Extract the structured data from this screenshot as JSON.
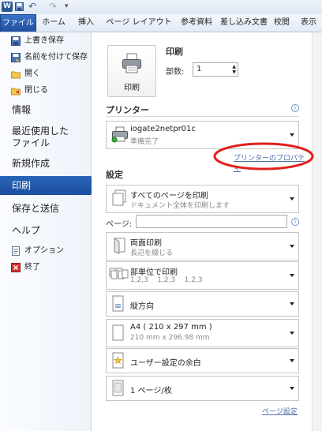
{
  "quick_access": {
    "app_icon_label": "W",
    "customize_label": "▾"
  },
  "ribbon": {
    "tabs": [
      "ファイル",
      "ホーム",
      "挿入",
      "ページ レイアウト",
      "参考資料",
      "差し込み文書",
      "校閲",
      "表示"
    ]
  },
  "backstage_nav": {
    "small_items_top": [
      {
        "label": "上書き保存",
        "icon": "save-icon"
      },
      {
        "label": "名前を付けて保存",
        "icon": "save-as-icon"
      },
      {
        "label": "開く",
        "icon": "open-folder-icon"
      },
      {
        "label": "閉じる",
        "icon": "close-folder-icon"
      }
    ],
    "big_items": [
      "情報",
      "最近使用した\nファイル",
      "新規作成",
      "印刷",
      "保存と送信",
      "ヘルプ"
    ],
    "selected": "印刷",
    "small_items_bottom": [
      {
        "label": "オプション",
        "icon": "options-icon"
      },
      {
        "label": "終了",
        "icon": "exit-icon"
      }
    ]
  },
  "print_panel": {
    "print_heading": "印刷",
    "print_button_label": "印刷",
    "copies_label": "部数:",
    "copies_value": "1",
    "printer_heading": "プリンター",
    "printer_name": "iogate2netpr01c",
    "printer_status": "準備完了",
    "printer_properties_link": "プリンターのプロパティ",
    "settings_heading": "設定",
    "pages_label": "ページ:",
    "pages_value": "",
    "settings": [
      {
        "title": "すべてのページを印刷",
        "subtitle": "ドキュメント全体を印刷します",
        "icon": "all-pages-icon"
      },
      {
        "title": "両面印刷",
        "subtitle": "長辺を綴じる",
        "icon": "duplex-icon"
      },
      {
        "title": "部単位で印刷",
        "subtitle": "1,2,3    1,2,3    1,2,3",
        "icon": "collate-icon"
      },
      {
        "title": "縦方向",
        "subtitle": "",
        "icon": "portrait-icon"
      },
      {
        "title": "A4 ( 210 x 297 mm )",
        "subtitle": "210 mm x 296.98 mm",
        "icon": "paper-size-icon"
      },
      {
        "title": "ユーザー設定の余白",
        "subtitle": "",
        "icon": "margins-icon"
      },
      {
        "title": "1 ページ/枚",
        "subtitle": "",
        "icon": "pages-per-sheet-icon"
      }
    ],
    "page_setup_link": "ページ設定"
  },
  "colors": {
    "accent": "#1f55a8",
    "annotation_circle": "#e0201c"
  }
}
